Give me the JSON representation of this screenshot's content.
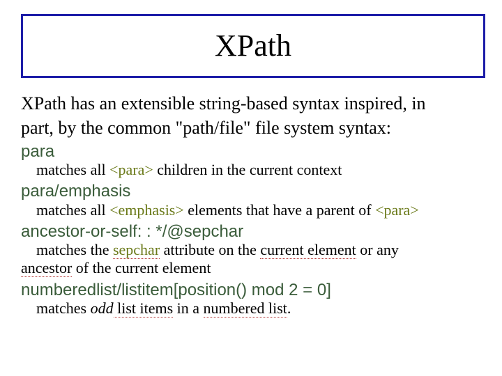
{
  "title": "XPath",
  "intro_line1": "XPath has an extensible string-based syntax inspired, in",
  "intro_line2": "part, by the common \"path/file\" file system syntax:",
  "examples": {
    "e1": {
      "expr": "para",
      "d1": "matches all ",
      "tag": "<para>",
      "d2": " children in the current context"
    },
    "e2": {
      "expr": "para/emphasis",
      "d1": "matches all ",
      "tag1": "<emphasis>",
      "d2": " elements that have a parent of ",
      "tag2": "<para>"
    },
    "e3": {
      "expr": "ancestor-or-self: : */@sepchar",
      "d1": "matches the ",
      "attr": "sepchar",
      "d2": " attribute on the ",
      "cur": "current element",
      "d3": " or any",
      "d4a": "ancestor",
      "d4b": " of the current element"
    },
    "e4": {
      "expr": "numberedlist/listitem[position() mod 2 = 0]",
      "d1": "matches ",
      "odd": "odd",
      "d2": " list items",
      "d3": " in a ",
      "nl": "numbered list",
      "d4": "."
    }
  }
}
